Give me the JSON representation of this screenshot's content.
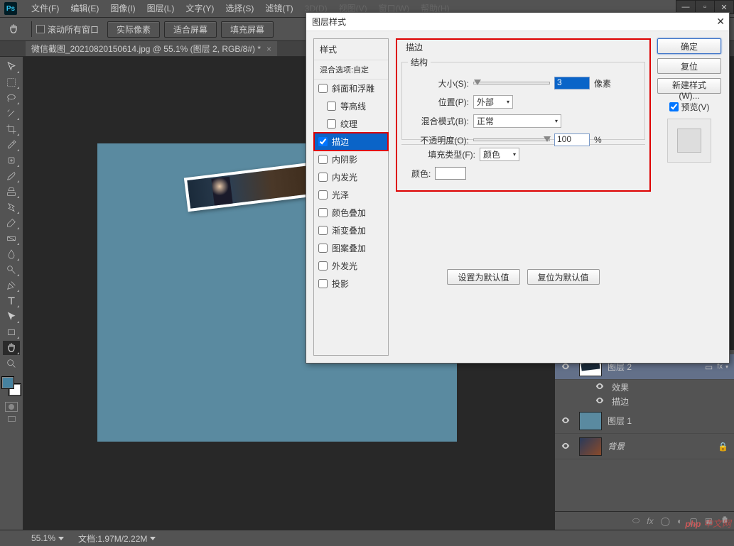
{
  "app": {
    "logo": "Ps"
  },
  "menu": {
    "items": [
      "文件(F)",
      "编辑(E)",
      "图像(I)",
      "图层(L)",
      "文字(Y)",
      "选择(S)",
      "滤镜(T)"
    ],
    "dim_items": [
      "3D(D)",
      "视图(V)",
      "窗口(W)",
      "帮助(H)"
    ]
  },
  "options": {
    "scroll_all": "滚动所有窗口",
    "actual_pixels": "实际像素",
    "fit_screen": "适合屏幕",
    "fill_screen": "填充屏幕"
  },
  "doc_tab": "微信截图_20210820150614.jpg @ 55.1% (图层 2, RGB/8#) *",
  "dialog": {
    "title": "图层样式",
    "styles_header": "样式",
    "blend_options": "混合选项:自定",
    "styles": [
      {
        "label": "斜面和浮雕",
        "checked": false,
        "indent": 0
      },
      {
        "label": "等高线",
        "checked": false,
        "indent": 1
      },
      {
        "label": "纹理",
        "checked": false,
        "indent": 1
      },
      {
        "label": "描边",
        "checked": true,
        "indent": 0,
        "selected": true
      },
      {
        "label": "内阴影",
        "checked": false,
        "indent": 0
      },
      {
        "label": "内发光",
        "checked": false,
        "indent": 0
      },
      {
        "label": "光泽",
        "checked": false,
        "indent": 0
      },
      {
        "label": "颜色叠加",
        "checked": false,
        "indent": 0
      },
      {
        "label": "渐变叠加",
        "checked": false,
        "indent": 0
      },
      {
        "label": "图案叠加",
        "checked": false,
        "indent": 0
      },
      {
        "label": "外发光",
        "checked": false,
        "indent": 0
      },
      {
        "label": "投影",
        "checked": false,
        "indent": 0
      }
    ],
    "stroke": {
      "title": "描边",
      "group_structure": "结构",
      "size_label": "大小(S):",
      "size_value": "3",
      "size_unit": "像素",
      "position_label": "位置(P):",
      "position_value": "外部",
      "blend_label": "混合模式(B):",
      "blend_value": "正常",
      "opacity_label": "不透明度(O):",
      "opacity_value": "100",
      "opacity_unit": "%",
      "fill_type_label": "填充类型(F):",
      "fill_type_value": "颜色",
      "color_label": "颜色:"
    },
    "buttons": {
      "make_default": "设置为默认值",
      "reset_default": "复位为默认值",
      "ok": "确定",
      "cancel": "复位",
      "new_style": "新建样式(W)...",
      "preview": "预览(V)"
    }
  },
  "layers": {
    "items": [
      {
        "name": "图层 2",
        "selected": true,
        "fx": true
      },
      {
        "name": "图层 1"
      },
      {
        "name": "背景",
        "italic": true,
        "locked": true
      }
    ],
    "fx_label": "fx",
    "sub_effects": "效果",
    "sub_stroke": "描边",
    "link_icon": "⬭"
  },
  "status": {
    "zoom": "55.1%",
    "doc_info": "文档:1.97M/2.22M"
  },
  "watermark": "php 中文网"
}
